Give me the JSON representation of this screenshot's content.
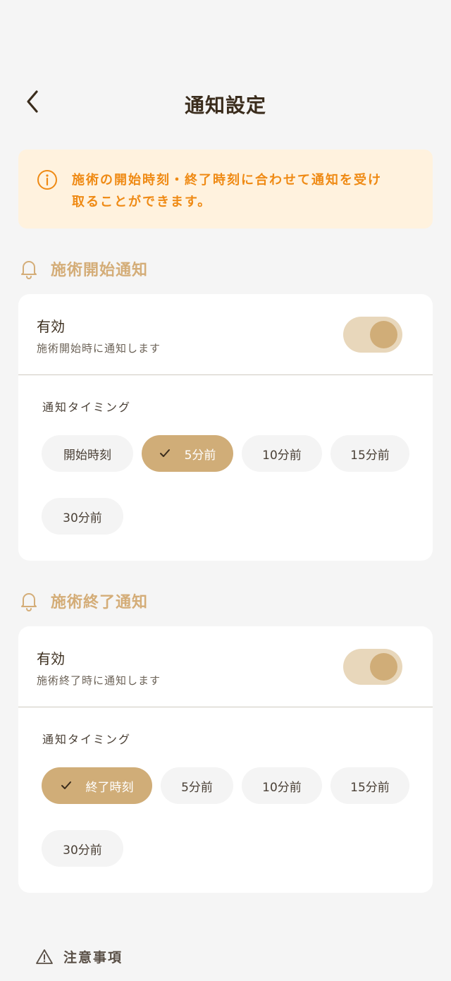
{
  "header": {
    "title": "通知設定",
    "back_icon": "chevron-left-icon"
  },
  "info": {
    "icon": "info-icon",
    "line1": "施術の開始時刻・終了時刻に合わせて通知を受け",
    "line2": "取ることができます。"
  },
  "colors": {
    "accent": "#d0ad78",
    "info_text": "#ef8a14",
    "info_bg": "#fff2de"
  },
  "start_section": {
    "title": "施術開始通知",
    "enable_label": "有効",
    "enable_desc": "施術開始時に通知します",
    "enabled": true,
    "timing_label": "通知タイミング",
    "options": [
      "開始時刻",
      "5分前",
      "10分前",
      "15分前",
      "30分前"
    ],
    "selected": "5分前"
  },
  "end_section": {
    "title": "施術終了通知",
    "enable_label": "有効",
    "enable_desc": "施術終了時に通知します",
    "enabled": true,
    "timing_label": "通知タイミング",
    "options": [
      "終了時刻",
      "5分前",
      "10分前",
      "15分前",
      "30分前"
    ],
    "selected": "終了時刻"
  },
  "notice": {
    "title": "注意事項"
  }
}
